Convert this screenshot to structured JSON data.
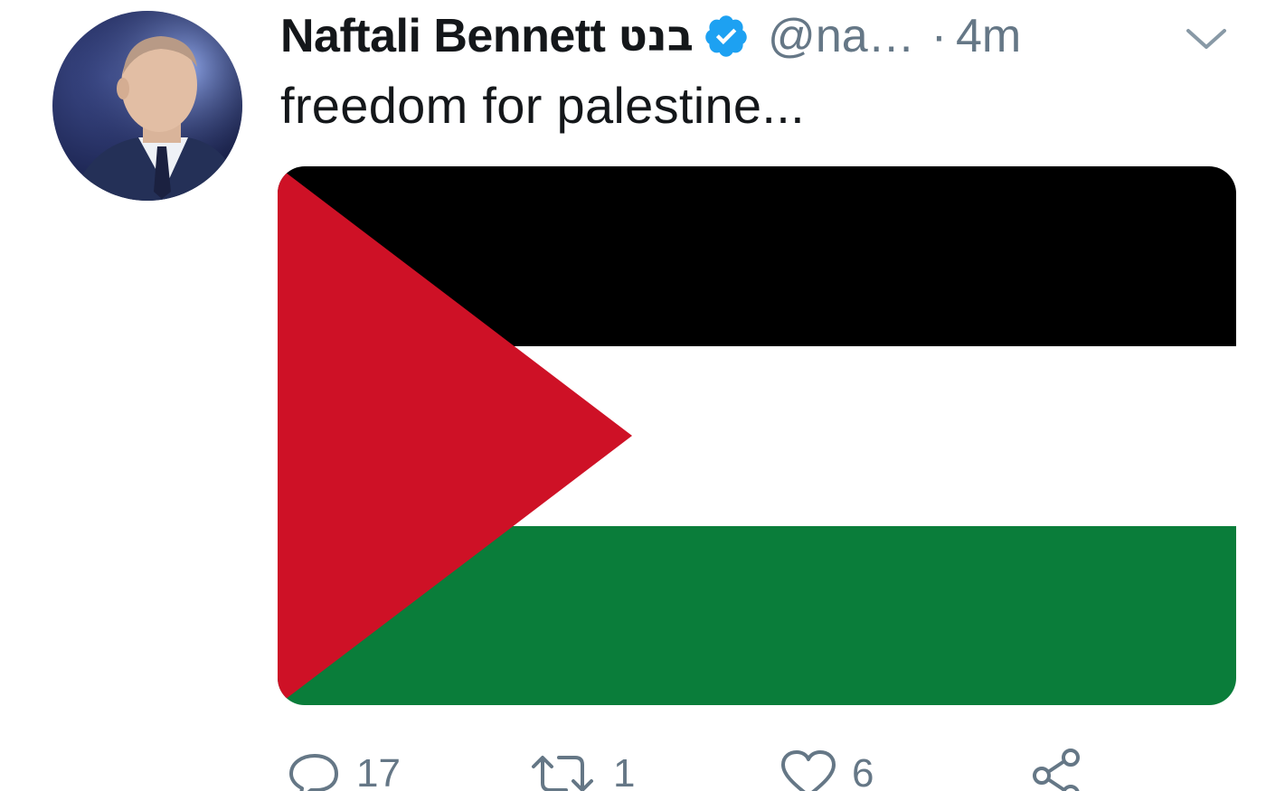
{
  "tweet": {
    "author": {
      "display_name": "Naftali Bennett",
      "hebrew_name": "בנט",
      "verified": true,
      "handle": "@na…",
      "avatar_icon": "profile-photo"
    },
    "separator": "·",
    "timestamp": "4m",
    "menu_icon": "chevron-down-icon",
    "text": "freedom for palestine...",
    "media": {
      "type": "image",
      "depicts": "palestinian-flag",
      "colors": {
        "black": "#000000",
        "white": "#ffffff",
        "green": "#0a7d3a",
        "red": "#ce1126"
      }
    },
    "actions": {
      "reply_count": "17",
      "retweet_count": "1",
      "like_count": "6"
    }
  },
  "colors": {
    "text_primary": "#14171a",
    "text_secondary": "#657786",
    "verified_blue": "#1da1f2"
  }
}
